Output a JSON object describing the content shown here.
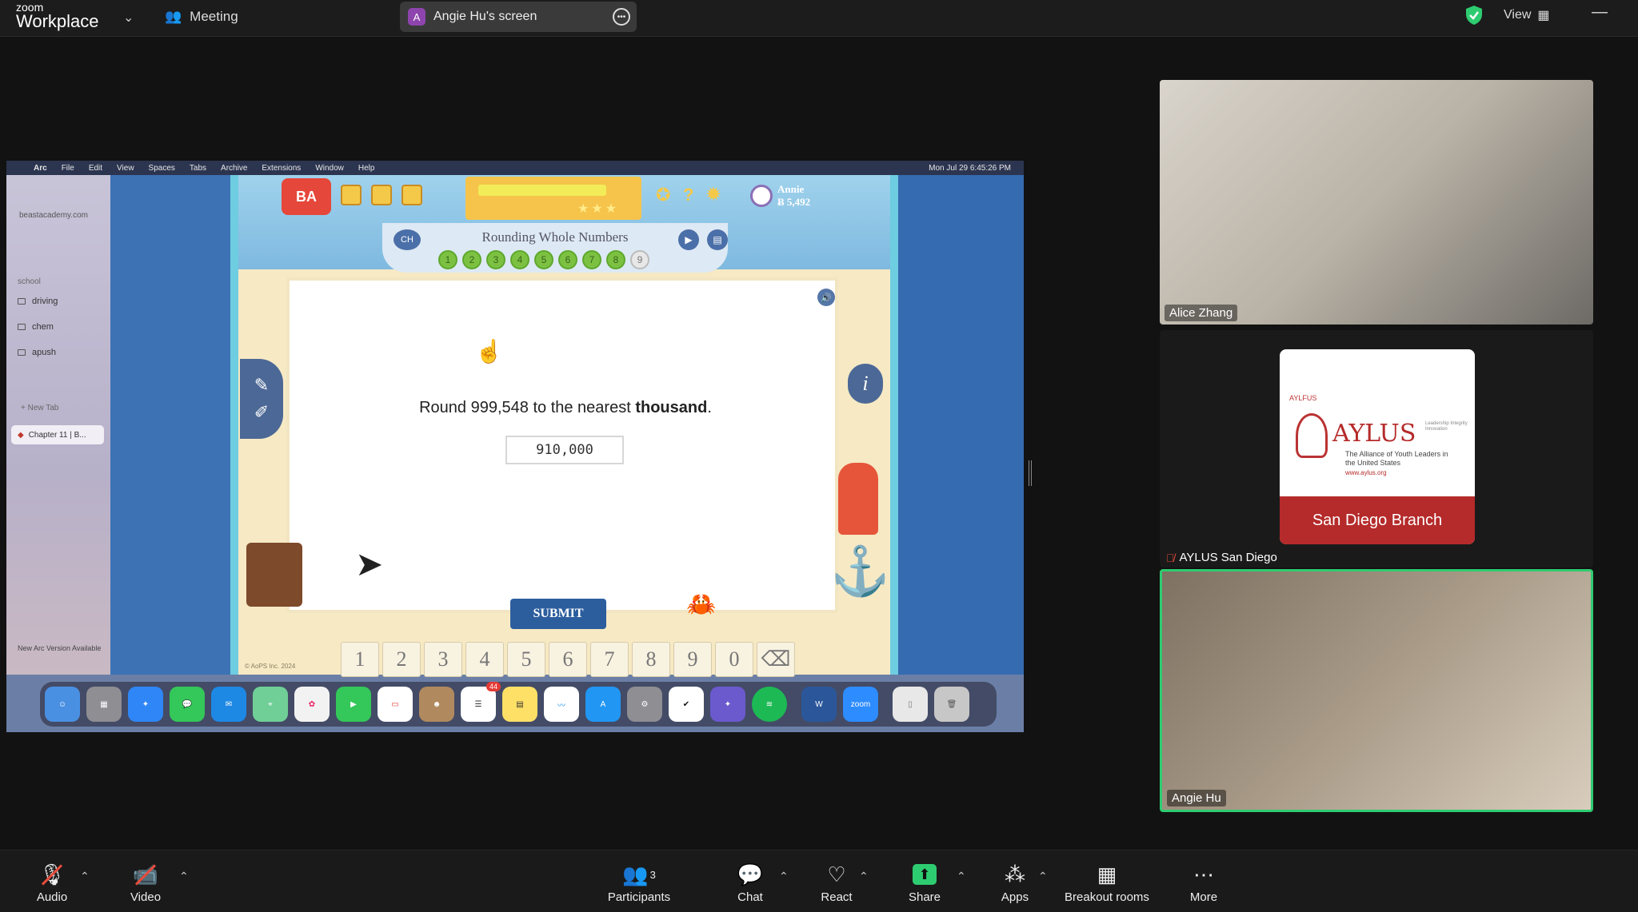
{
  "titlebar": {
    "brand_top": "zoom",
    "brand_bottom": "Workplace",
    "meeting_label": "Meeting",
    "screen_pill_initial": "A",
    "screen_pill_label": "Angie Hu's screen",
    "view_label": "View"
  },
  "shared_screen": {
    "mac_menu": [
      "Arc",
      "File",
      "Edit",
      "View",
      "Spaces",
      "Tabs",
      "Archive",
      "Extensions",
      "Window",
      "Help"
    ],
    "mac_clock": "Mon Jul 29  6:45:26 PM",
    "arc_sidebar": {
      "url": "beastacademy.com",
      "section": "school",
      "folders": [
        "driving",
        "chem",
        "apush"
      ],
      "new_tab": "+ New Tab",
      "active_tab": "Chapter 11 | B...",
      "update_notice": "New Arc Version Available"
    },
    "game": {
      "logo": "BA",
      "user_name": "Annie",
      "user_points": "Ƀ 5,492",
      "lesson_title": "Rounding Whole Numbers",
      "ch_label": "CH",
      "progress_dots": [
        "1",
        "2",
        "3",
        "4",
        "5",
        "6",
        "7",
        "8",
        "9"
      ],
      "current_dot": "9",
      "question_prefix": "Round 999,548 to the nearest ",
      "question_bold": "thousand",
      "question_suffix": ".",
      "answer_value": "910,000",
      "submit_label": "SUBMIT",
      "keypad": [
        "1",
        "2",
        "3",
        "4",
        "5",
        "6",
        "7",
        "8",
        "9",
        "0"
      ],
      "backspace_icon": "backspace-icon",
      "copyright": "© AoPS Inc. 2024"
    },
    "dock_apps": [
      "finder",
      "launchpad",
      "safari",
      "messages",
      "mail",
      "maps",
      "photos",
      "facetime",
      "calendar",
      "contacts",
      "reminders",
      "notes",
      "freeform",
      "app-store",
      "settings",
      "tasks",
      "keynote",
      "spotify",
      "word",
      "zoom",
      "documents",
      "trash"
    ],
    "dock_badge": "44"
  },
  "videos": {
    "v1_name": "Alice Zhang",
    "v2_name": "AYLUS San Diego",
    "v3_name": "Angie Hu",
    "aylus_small": "AYLFUS",
    "aylus_title": "AYLUS",
    "aylus_sub": "The Alliance of Youth Leaders in the United States",
    "aylus_url": "www.aylus.org",
    "aylus_tagline": "Leadership Integrity Innovation",
    "aylus_branch": "San Diego Branch"
  },
  "toolbar": {
    "audio": "Audio",
    "video": "Video",
    "participants": "Participants",
    "participants_count": "3",
    "chat": "Chat",
    "react": "React",
    "share": "Share",
    "apps": "Apps",
    "breakout": "Breakout rooms",
    "more": "More"
  },
  "colors": {
    "active_speaker_border": "#2ecc71",
    "mute_red": "#e74c3c",
    "aylus_red": "#b52a2a",
    "share_green": "#2ecc71"
  }
}
